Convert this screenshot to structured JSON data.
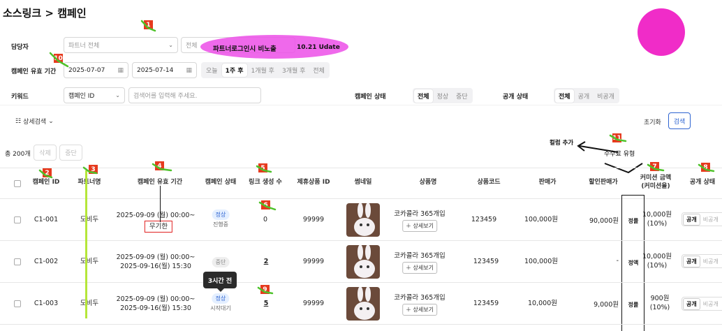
{
  "page_title": "소스링크 > 캠페인",
  "filters": {
    "manager_label": "담당자",
    "manager_select": "파트너 전체",
    "manager_second_select": "전체",
    "annotation_note": "파트너로그인시 비노출",
    "annotation_date": "10.21 Udate",
    "period_label": "캠페인 유효 기간",
    "date_start": "2025-07-07",
    "date_end": "2025-07-14",
    "period_options": [
      "오늘",
      "1주 후",
      "1개월 후",
      "3개월 후",
      "전체"
    ],
    "period_selected": "1주 후",
    "keyword_label": "키워드",
    "keyword_type": "캠페인 ID",
    "keyword_placeholder": "검색어를 입력해 주세요.",
    "status_label": "캠페인 상태",
    "status_options": [
      "전체",
      "정상",
      "중단"
    ],
    "status_selected": "전체",
    "public_label": "공개 상태",
    "public_options": [
      "전체",
      "공개",
      "비공개"
    ],
    "public_selected": "전체",
    "detail_search": "상세검색",
    "reset_label": "초기화",
    "search_label": "검색"
  },
  "list": {
    "total": "총 200개",
    "delete_label": "삭제",
    "stop_label": "중단",
    "columns": [
      "캠페인 ID",
      "파트너명",
      "캠페인 유효 기간",
      "캠페인 상태",
      "링크 생성 수",
      "제휴상품 ID",
      "썸네일",
      "상품명",
      "상품코드",
      "판매가",
      "할인판매가",
      "커미션 금액",
      "(커미션율)",
      "공개 상태"
    ],
    "rows": [
      {
        "id": "C1-001",
        "partner": "도비두",
        "period_line1": "2025-09-09 (월) 00:00~",
        "period_line2": "무기한",
        "status": "정상",
        "status_sub": "진행중",
        "links": "0",
        "product_id": "99999",
        "product_name": "코카콜라 365개입",
        "detail_btn": "상세보기",
        "code": "123459",
        "price": "100,000원",
        "discount": "90,000원",
        "comm_type": "정률",
        "commission": "10,000원",
        "rate": "(10%)",
        "pub_on": "공개",
        "pub_off": "비공개"
      },
      {
        "id": "C1-002",
        "partner": "도비두",
        "period_line1": "2025-09-09 (월) 00:00~",
        "period_line2": "2025-09-16(월) 15:30",
        "status": "중단",
        "status_sub": "",
        "links": "2",
        "product_id": "99999",
        "product_name": "코카콜라 365개입",
        "detail_btn": "상세보기",
        "code": "123459",
        "price": "100,000원",
        "discount": "-",
        "comm_type": "정액",
        "commission": "10,000원",
        "rate": "(10%)",
        "pub_on": "공개",
        "pub_off": "비공개"
      },
      {
        "id": "C1-003",
        "partner": "도비두",
        "period_line1": "2025-09-09 (월) 00:00~",
        "period_line2": "2025-09-16(월) 15:30",
        "status": "정상",
        "status_sub": "시작대기",
        "links": "5",
        "product_id": "99999",
        "product_name": "코카콜라 365개입",
        "detail_btn": "상세보기",
        "code": "123459",
        "price": "10,000원",
        "discount": "9,000원",
        "comm_type": "정률",
        "commission": "900원",
        "rate": "(10%)",
        "pub_on": "공개",
        "pub_off": "비공개"
      }
    ]
  },
  "annotations": {
    "tooltip": "3시간 전",
    "column_add": "컬럼 추가",
    "fee_type": "수수료 유형",
    "markers": [
      "1",
      "2",
      "3",
      "4",
      "5",
      "6",
      "7",
      "8",
      "9",
      "10",
      "11"
    ]
  },
  "colors": {
    "accent": "#2e64d1",
    "marker": "#e63a1e",
    "highlight": "#ec4fe8",
    "magenta": "#f02cc8",
    "green_line": "#b5e63a"
  },
  "icons": [
    "calendar-icon",
    "chevron-down-icon",
    "filter-icon",
    "plus-icon"
  ]
}
